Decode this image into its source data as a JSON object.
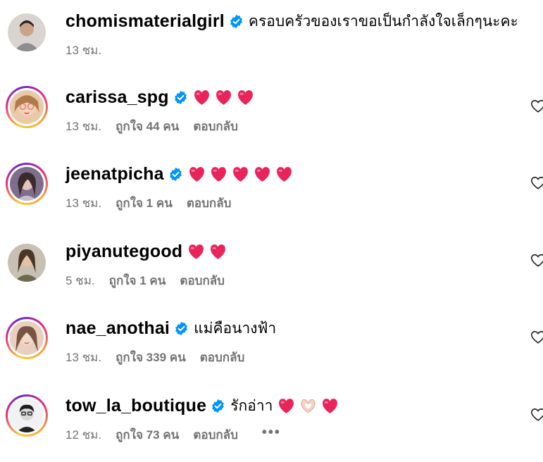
{
  "comments": [
    {
      "username": "chomismaterialgirl",
      "verified": true,
      "text": "ครอบครัวของเราขอเป็นกำลังใจเล็กๆนะคะ",
      "emojis": [],
      "time": "13 ชม.",
      "likes": "",
      "reply": "",
      "story_ring": false,
      "show_like": false
    },
    {
      "username": "carissa_spg",
      "verified": true,
      "text": "",
      "emojis": [
        "heart",
        "heart",
        "heart"
      ],
      "time": "13 ชม.",
      "likes": "ถูกใจ 44 คน",
      "reply": "ตอบกลับ",
      "story_ring": true,
      "show_like": true
    },
    {
      "username": "jeenatpicha",
      "verified": true,
      "text": "",
      "emojis": [
        "heart",
        "heart",
        "heart",
        "heart",
        "heart"
      ],
      "time": "13 ชม.",
      "likes": "ถูกใจ 1 คน",
      "reply": "ตอบกลับ",
      "story_ring": true,
      "show_like": true
    },
    {
      "username": "piyanutegood",
      "verified": false,
      "text": "",
      "emojis": [
        "heart",
        "heart"
      ],
      "time": "5 ชม.",
      "likes": "ถูกใจ 1 คน",
      "reply": "ตอบกลับ",
      "story_ring": false,
      "show_like": true
    },
    {
      "username": "nae_anothai",
      "verified": true,
      "text": "แม่คือนางฟ้า",
      "emojis": [],
      "time": "13 ชม.",
      "likes": "ถูกใจ 339 คน",
      "reply": "ตอบกลับ",
      "story_ring": true,
      "show_like": true
    },
    {
      "username": "tow_la_boutique",
      "verified": true,
      "text": "รักอ่าา",
      "emojis": [
        "heart",
        "heart-hands",
        "heart"
      ],
      "time": "12 ชม.",
      "likes": "ถูกใจ 73 คน",
      "reply": "ตอบกลับ",
      "more": "•••",
      "story_ring": true,
      "show_like": true
    }
  ],
  "colors": {
    "verified_badge": "#0095f6",
    "heart_emoji": "#e8245a",
    "meta_text": "#737373"
  }
}
